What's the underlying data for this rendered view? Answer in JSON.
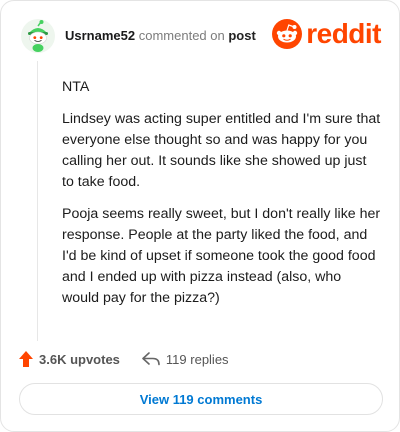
{
  "header": {
    "username": "Usrname52",
    "verb": "commented on",
    "link_text": "post",
    "logo_text": "reddit"
  },
  "comment": {
    "paragraphs": [
      "NTA",
      "Lindsey was acting super entitled and I'm sure that everyone else thought so and was happy for you calling her out. It sounds like she showed up just to take food.",
      "Pooja seems really sweet, but I don't really like her response. People at the party liked the food, and I'd be kind of upset if someone took the good food and I ended up with pizza instead (also, who would pay for the pizza?)"
    ]
  },
  "actions": {
    "upvotes": "3.6K upvotes",
    "replies": "119 replies"
  },
  "view_button": "View 119 comments",
  "colors": {
    "brand": "#ff4500",
    "link": "#0079d3",
    "avatar_green": "#46d160"
  },
  "icons": [
    "snoo-avatar-icon",
    "reddit-logo-icon",
    "upvote-arrow-icon",
    "reply-arrow-icon"
  ]
}
